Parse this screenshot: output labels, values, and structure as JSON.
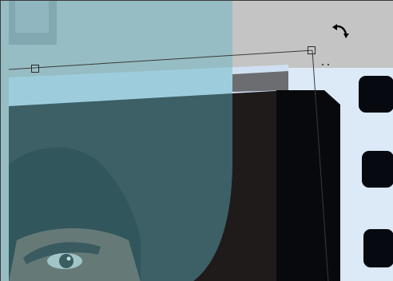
{
  "document": {
    "subject": "",
    "tool": "free-transform"
  },
  "transform": {
    "handles": [
      "top-left-handle",
      "top-right-handle"
    ],
    "cursor": "rotate-cursor-icon"
  },
  "colors": {
    "pasteboard": "#c5c5c5",
    "cyan_overlay": "#66b2be",
    "film_dark": "#0b0f14",
    "film_frame_light": "#dbe8f6",
    "bounding_box": "#3a3a3a"
  }
}
